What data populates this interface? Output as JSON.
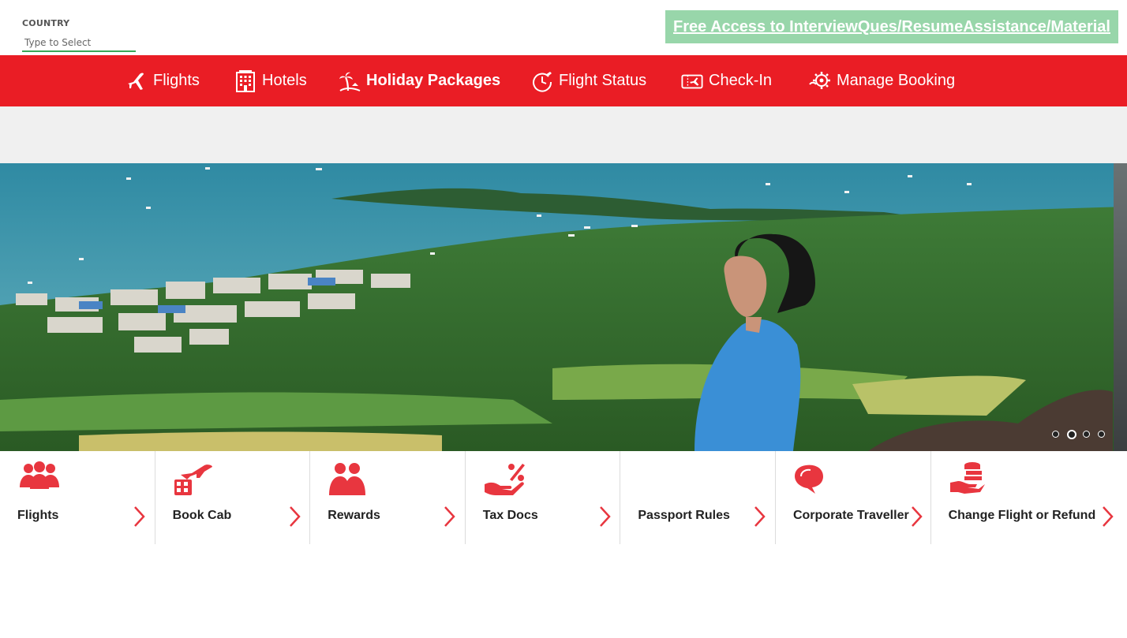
{
  "header": {
    "country_label": "COUNTRY",
    "country_placeholder": "Type to Select",
    "promo_text": "Free Access to InterviewQues/ResumeAssistance/Material"
  },
  "nav": {
    "items": [
      {
        "label": "Flights",
        "icon": "plane-icon"
      },
      {
        "label": "Hotels",
        "icon": "hotel-icon"
      },
      {
        "label": "Holiday Packages",
        "icon": "palm-tree-icon",
        "active": true
      },
      {
        "label": "Flight Status",
        "icon": "clock-plane-icon"
      },
      {
        "label": "Check-In",
        "icon": "ticket-icon"
      },
      {
        "label": "Manage Booking",
        "icon": "gear-cloud-icon"
      }
    ]
  },
  "carousel": {
    "slide_count": 4,
    "active_index": 1
  },
  "tiles": [
    {
      "label": "Flights",
      "icon": "group-people-icon"
    },
    {
      "label": "Book Cab",
      "icon": "cab-plane-icon"
    },
    {
      "label": "Rewards",
      "icon": "people-icon"
    },
    {
      "label": "Tax Docs",
      "icon": "hand-percent-icon"
    },
    {
      "label": "Passport Rules",
      "icon": ""
    },
    {
      "label": "Corporate Traveller",
      "icon": "chat-bubble-icon"
    },
    {
      "label": "Change Flight or Refund",
      "icon": "hand-coins-icon"
    }
  ],
  "colors": {
    "brand_red": "#ea1d25",
    "promo_green": "#98d6aa",
    "input_underline": "#3aa757",
    "tile_icon_red": "#e8363f"
  }
}
